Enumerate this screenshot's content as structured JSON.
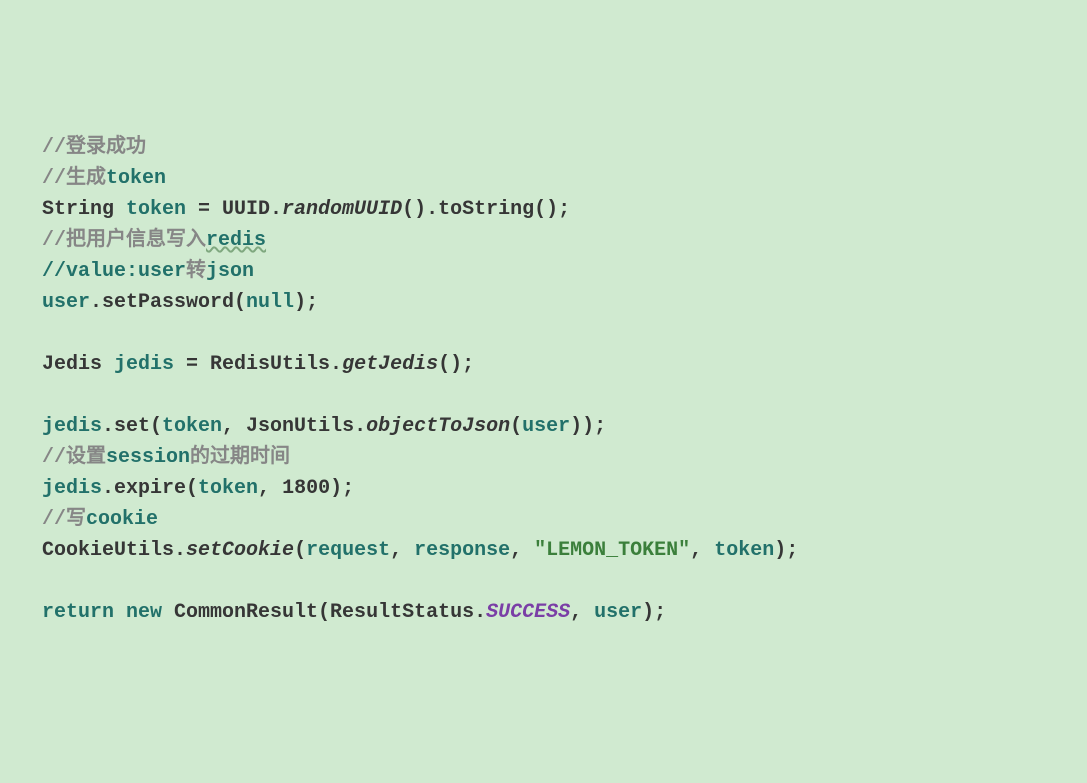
{
  "lines": {
    "c1_a": "//",
    "c1_b": "登录成功",
    "c2_a": "//",
    "c2_b": "生成",
    "c2_c": "token",
    "l3_a": "String ",
    "l3_b": "token ",
    "l3_c": "= UUID.",
    "l3_d": "randomUUID",
    "l3_e": "().toString();",
    "c4_a": "//",
    "c4_b": "把用户信息写入",
    "c4_c": "redis",
    "c5_a": "//value:user",
    "c5_b": "转",
    "c5_c": "json",
    "l6_a": "user",
    "l6_b": ".setPassword(",
    "l6_c": "null",
    "l6_d": ");",
    "l8_a": "Jedis ",
    "l8_b": "jedis ",
    "l8_c": "= RedisUtils.",
    "l8_d": "getJedis",
    "l8_e": "();",
    "l10_a": "jedis",
    "l10_b": ".set(",
    "l10_c": "token",
    "l10_d": ", JsonUtils.",
    "l10_e": "objectToJson",
    "l10_f": "(",
    "l10_g": "user",
    "l10_h": "));",
    "c11_a": "//",
    "c11_b": "设置",
    "c11_c": "session",
    "c11_d": "的过期时间",
    "l12_a": "jedis",
    "l12_b": ".expire(",
    "l12_c": "token",
    "l12_d": ", ",
    "l12_e": "1800",
    "l12_f": ");",
    "c13_a": "//",
    "c13_b": "写",
    "c13_c": "cookie",
    "l14_a": "CookieUtils.",
    "l14_b": "setCookie",
    "l14_c": "(",
    "l14_d": "request",
    "l14_e": ", ",
    "l14_f": "response",
    "l14_g": ", ",
    "l14_h": "\"LEMON_TOKEN\"",
    "l14_i": ", ",
    "l14_j": "token",
    "l14_k": ");",
    "l16_a": "return new ",
    "l16_b": "CommonResult(ResultStatus.",
    "l16_c": "SUCCESS",
    "l16_d": ", ",
    "l16_e": "user",
    "l16_f": ");"
  }
}
